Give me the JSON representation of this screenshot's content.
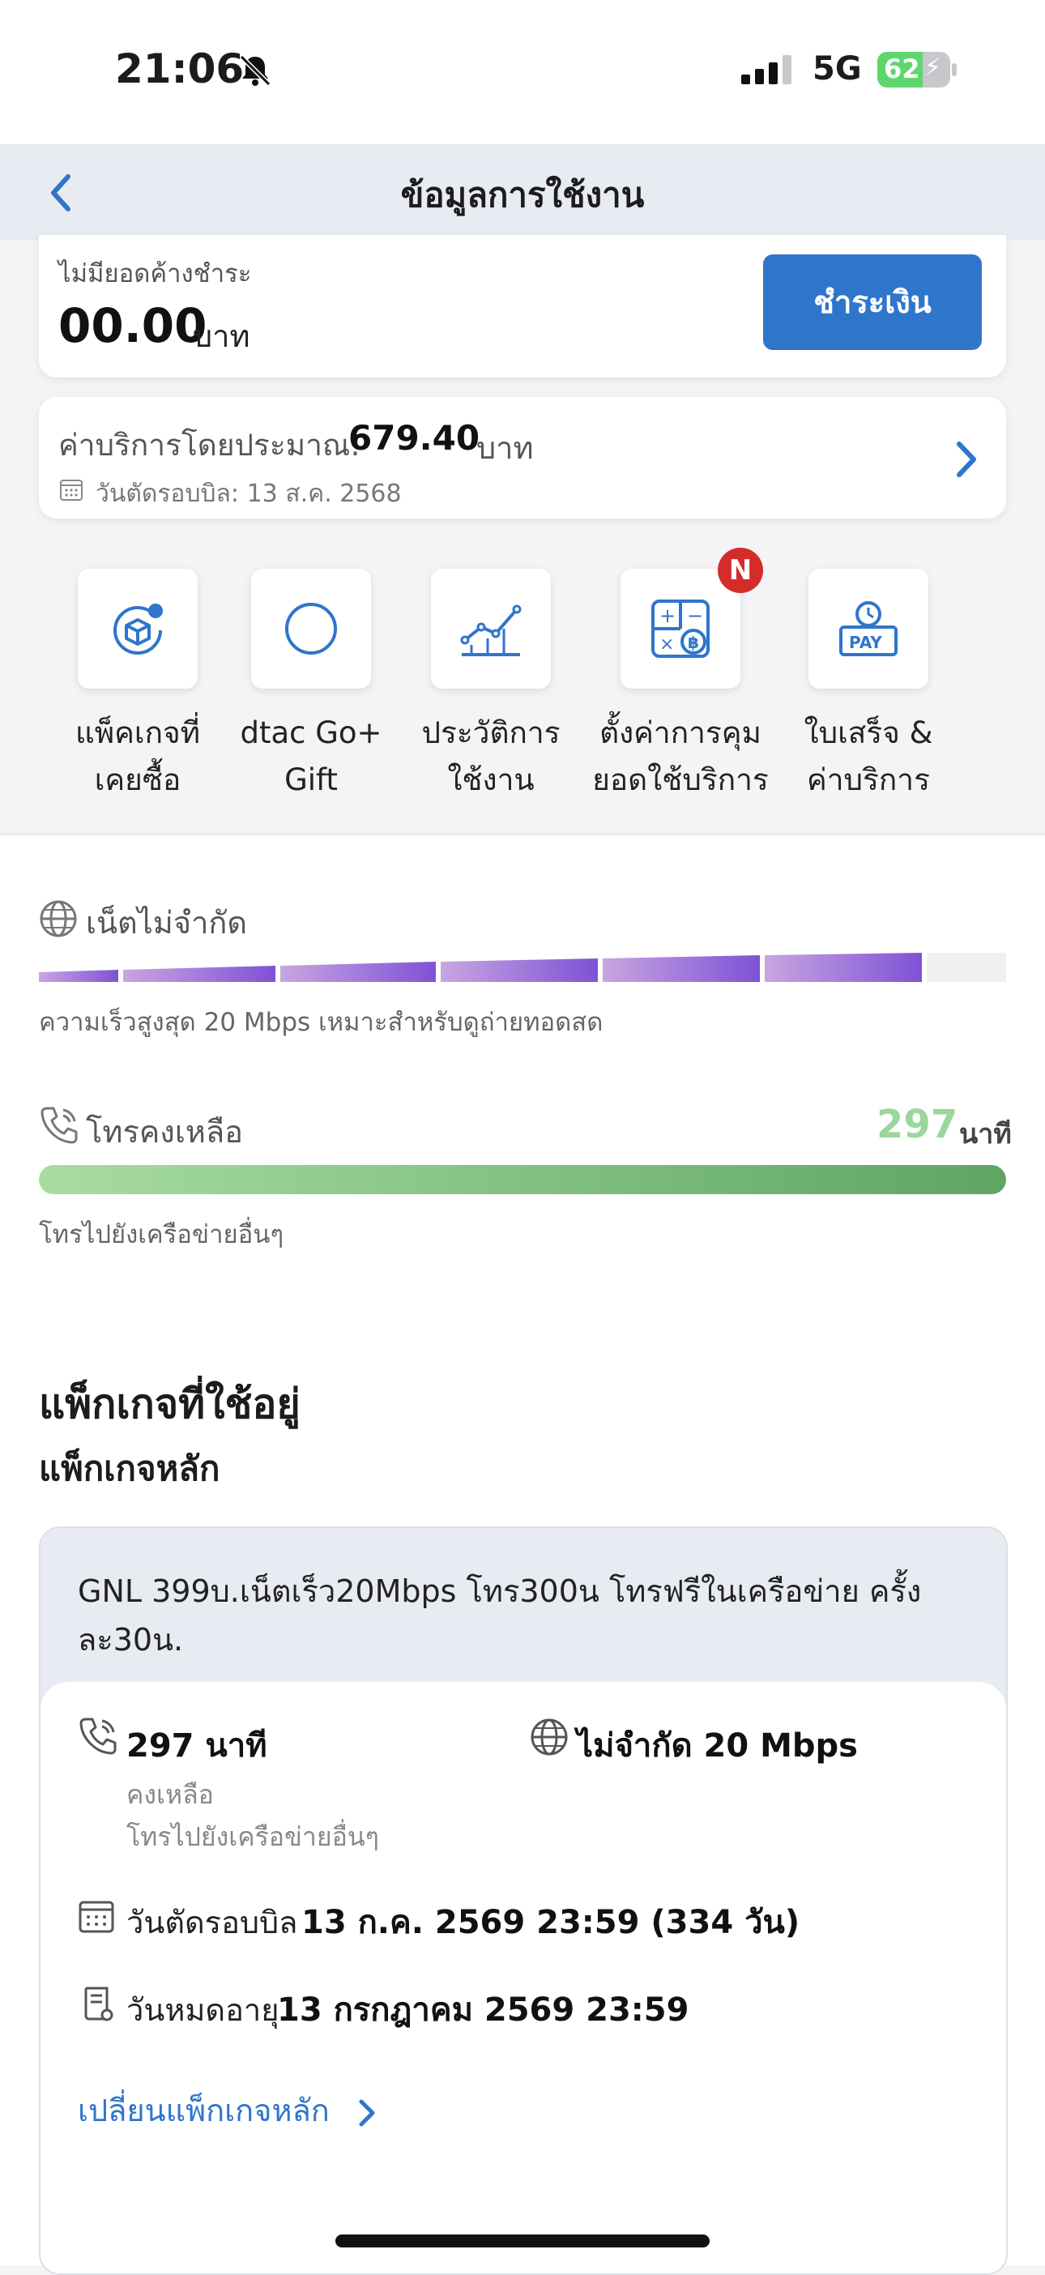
{
  "status_bar": {
    "time": "21:06",
    "network": "5G",
    "battery": "62",
    "battery_level": 0.62
  },
  "header": {
    "title": "ข้อมูลการใช้งาน"
  },
  "outstanding": {
    "label": "ไม่มียอดค้างชำระ",
    "amount": "00.00",
    "unit": "บาท",
    "pay_button": "ชำระเงิน"
  },
  "estimate": {
    "label": "ค่าบริการโดยประมาณ:",
    "amount": "679.40",
    "unit": "บาท",
    "cycle": "วันตัดรอบบิล: 13 ส.ค. 2568"
  },
  "shortcuts": [
    {
      "line1": "แพ็คเกจที่",
      "line2": "เคยซื้อ",
      "icon": "box-history-icon"
    },
    {
      "line1": "dtac Go+",
      "line2": "Gift",
      "icon": "circle-icon"
    },
    {
      "line1": "ประวัติการ",
      "line2": "ใช้งาน",
      "icon": "chart-icon"
    },
    {
      "line1": "ตั้งค่าการคุม",
      "line2": "ยอดใช้บริการ",
      "icon": "calculator-icon",
      "badge": "N"
    },
    {
      "line1": "ใบเสร็จ &",
      "line2": "ค่าบริการ",
      "icon": "pay-clock-icon"
    }
  ],
  "internet": {
    "title": "เน็ตไม่จำกัด",
    "description": "ความเร็วสูงสุด 20 Mbps เหมาะสำหรับดูถ่ายทอดสด"
  },
  "calls": {
    "title": "โทรคงเหลือ",
    "minutes": "297",
    "unit": "นาที",
    "description": "โทรไปยังเครือข่ายอื่นๆ"
  },
  "packages": {
    "heading": "แพ็กเกจที่ใช้อยู่",
    "subheading": "แพ็กเกจหลัก",
    "main": {
      "name": "GNL 399บ.เน็ตเร็ว20Mbps โทร300น โทรฟรีในเครือข่าย ครั้งละ30น.",
      "call_amount": "297 นาที",
      "call_remaining": "คงเหลือ",
      "call_desc": "โทรไปยังเครือข่ายอื่นๆ",
      "data_amount": "ไม่จำกัด 20 Mbps",
      "cycle_label": "วันตัดรอบบิล",
      "cycle_value": "13 ก.ค. 2569 23:59 (334 วัน)",
      "expiry_label": "วันหมดอายุ",
      "expiry_value": "13 กรกฎาคม 2569 23:59",
      "change_link": "เปลี่ยนแพ็กเกจหลัก"
    }
  },
  "colors": {
    "accent": "#2f75cc",
    "badge": "#d42b2b",
    "call_bar_start": "#a8dd9f",
    "call_bar_end": "#5ea563",
    "data_bar": "#8b5fd3"
  }
}
